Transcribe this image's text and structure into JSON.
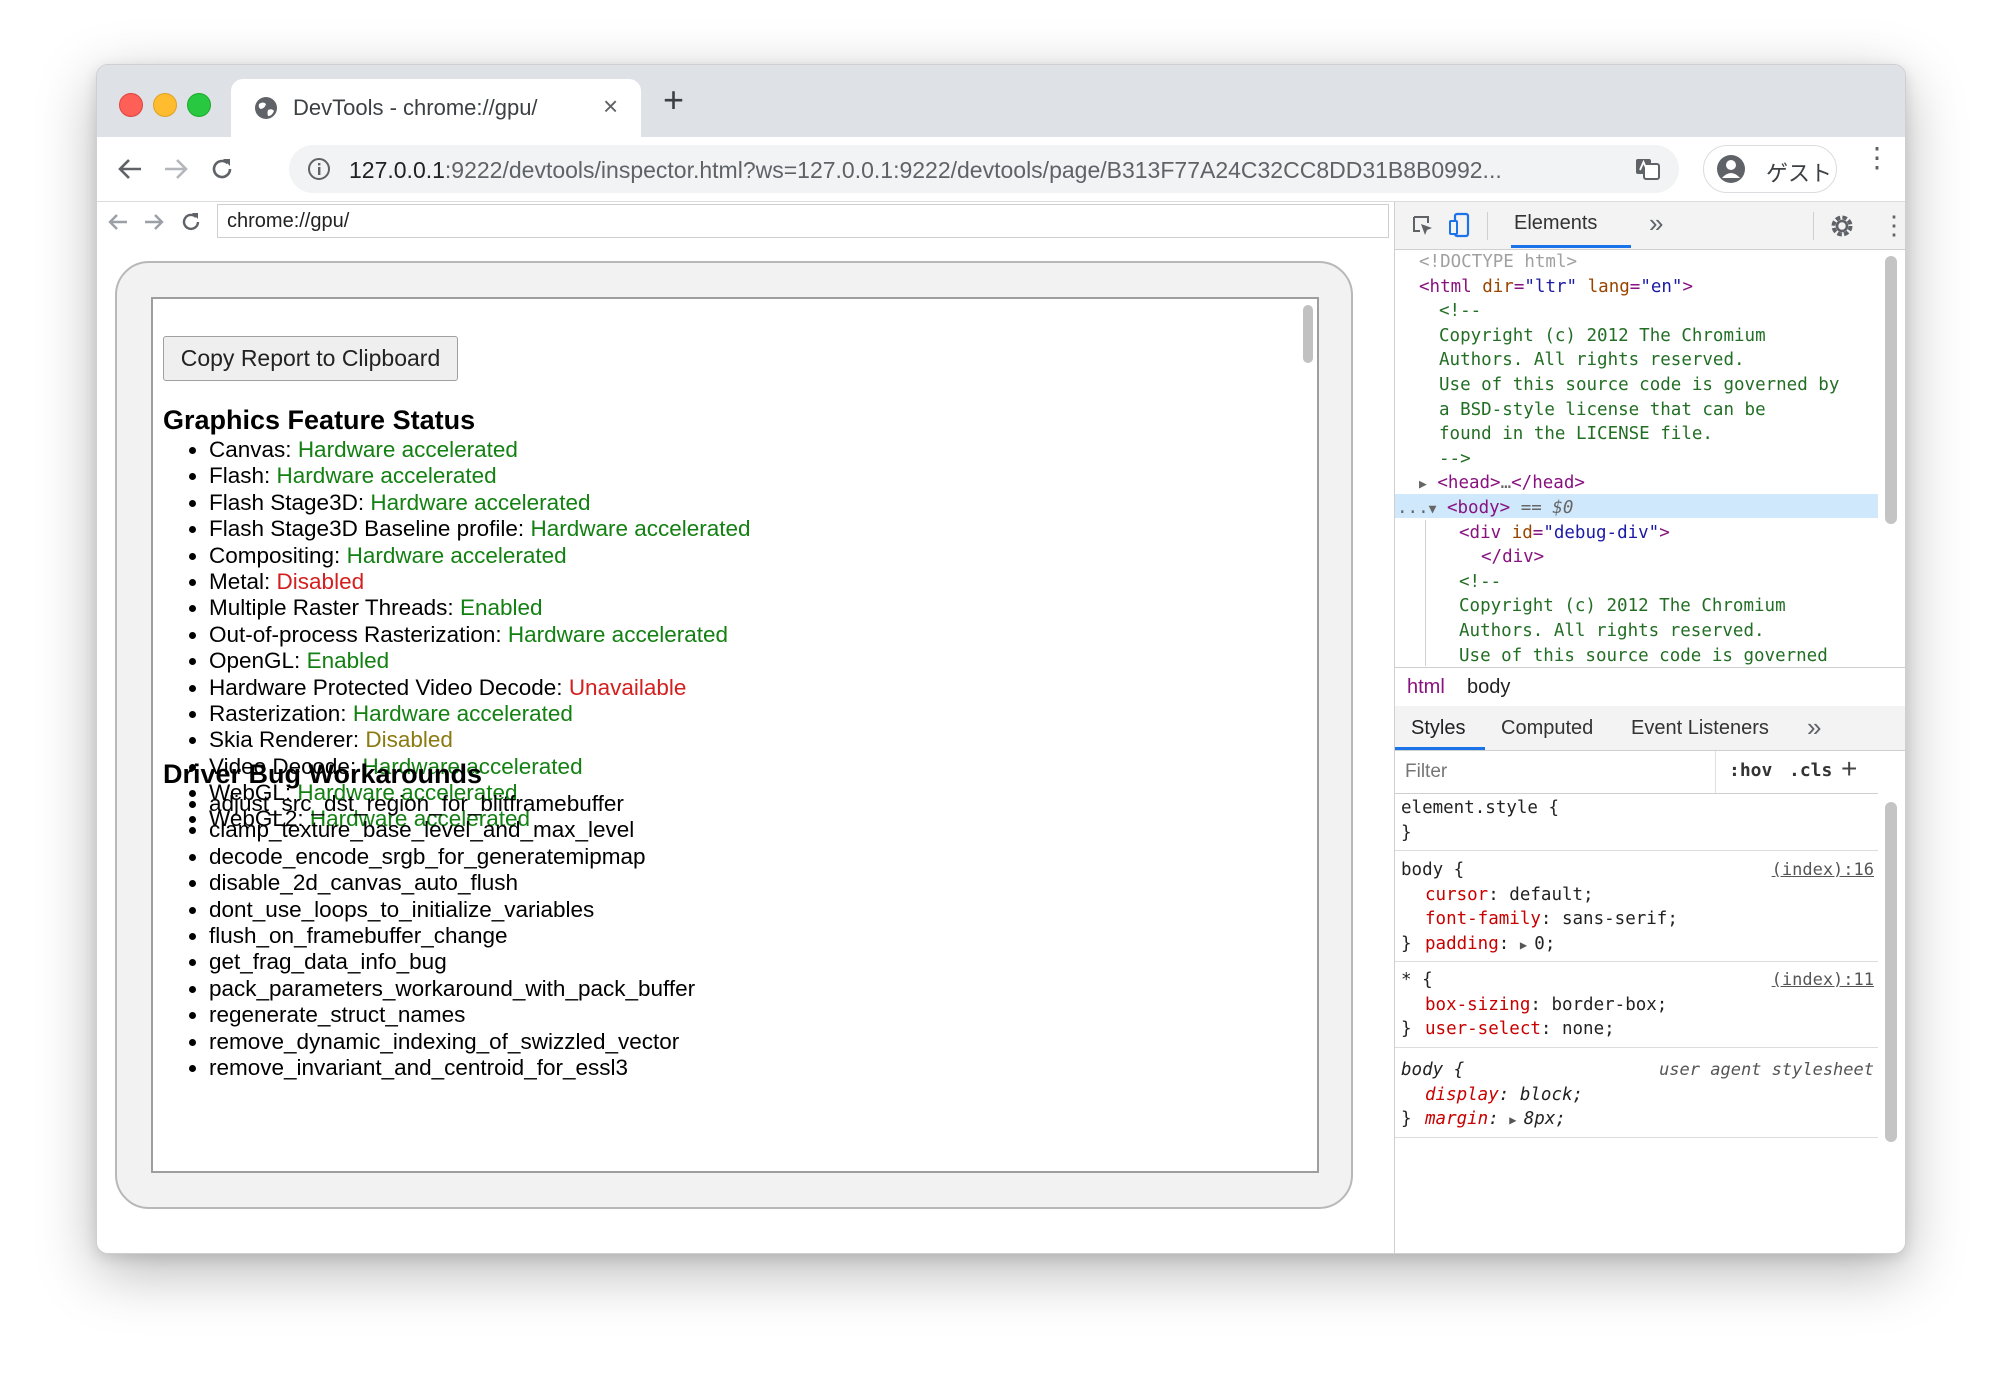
{
  "browser": {
    "tab_title": "DevTools - chrome://gpu/",
    "tab_close": "×",
    "new_tab": "+",
    "url_host": "127.0.0.1",
    "url_rest": ":9222/devtools/inspector.html?ws=127.0.0.1:9222/devtools/page/B313F77A24C32CC8DD31B8B0992...",
    "profile_name": "ゲスト",
    "menu": "⋮"
  },
  "inspector": {
    "url": "chrome://gpu/",
    "copy_button": "Copy Report to Clipboard",
    "feature_status_heading": "Graphics Feature Status",
    "features": [
      {
        "name": "Canvas:",
        "status": "Hardware accelerated",
        "color": "#138012"
      },
      {
        "name": "Flash:",
        "status": "Hardware accelerated",
        "color": "#138012"
      },
      {
        "name": "Flash Stage3D:",
        "status": "Hardware accelerated",
        "color": "#138012"
      },
      {
        "name": "Flash Stage3D Baseline profile:",
        "status": "Hardware accelerated",
        "color": "#138012"
      },
      {
        "name": "Compositing:",
        "status": "Hardware accelerated",
        "color": "#138012"
      },
      {
        "name": "Metal:",
        "status": "Disabled",
        "color": "#d41f1f"
      },
      {
        "name": "Multiple Raster Threads:",
        "status": "Enabled",
        "color": "#138012"
      },
      {
        "name": "Out-of-process Rasterization:",
        "status": "Hardware accelerated",
        "color": "#138012"
      },
      {
        "name": "OpenGL:",
        "status": "Enabled",
        "color": "#138012"
      },
      {
        "name": "Hardware Protected Video Decode:",
        "status": "Unavailable",
        "color": "#d41f1f"
      },
      {
        "name": "Rasterization:",
        "status": "Hardware accelerated",
        "color": "#138012"
      },
      {
        "name": "Skia Renderer:",
        "status": "Disabled",
        "color": "#8a7a10"
      },
      {
        "name": "Video Decode:",
        "status": "Hardware accelerated",
        "color": "#138012"
      },
      {
        "name": "WebGL:",
        "status": "Hardware accelerated",
        "color": "#138012"
      },
      {
        "name": "WebGL2:",
        "status": "Hardware accelerated",
        "color": "#138012"
      }
    ],
    "workarounds_heading": "Driver Bug Workarounds",
    "workarounds": [
      "adjust_src_dst_region_for_blitframebuffer",
      "clamp_texture_base_level_and_max_level",
      "decode_encode_srgb_for_generatemipmap",
      "disable_2d_canvas_auto_flush",
      "dont_use_loops_to_initialize_variables",
      "flush_on_framebuffer_change",
      "get_frag_data_info_bug",
      "pack_parameters_workaround_with_pack_buffer",
      "regenerate_struct_names",
      "remove_dynamic_indexing_of_swizzled_vector",
      "remove_invariant_and_centroid_for_essl3"
    ]
  },
  "devtools": {
    "panel_tab": "Elements",
    "more": "»",
    "dom": {
      "doctype": "<!DOCTYPE html>",
      "html_open_tag": "<html",
      "html_attr1_name": "dir",
      "html_attr1_value": "\"ltr\"",
      "html_attr2_name": "lang",
      "html_attr2_value": "\"en\"",
      "html_close_bracket": ">",
      "comment_lines": [
        "<!--",
        "Copyright (c) 2012 The Chromium",
        "Authors. All rights reserved.",
        "Use of this source code is governed by",
        "a BSD-style license that can be",
        "found in the LICENSE file.",
        "-->"
      ],
      "head_open": "<head>",
      "head_ellipsis": "…",
      "head_close": "</head>",
      "body_dots": "...",
      "body_tag": "<body>",
      "body_marker": "== $0",
      "div_open": "<div",
      "div_attr_name": "id",
      "div_attr_value": "\"debug-div\"",
      "div_close_bracket": ">",
      "div_close": "</div>",
      "comment2_lines": [
        "<!--",
        "Copyright (c) 2012 The Chromium",
        "Authors. All rights reserved.",
        "Use of this source code is governed"
      ]
    },
    "breadcrumbs": [
      "html",
      "body"
    ],
    "style_tabs": [
      "Styles",
      "Computed",
      "Event Listeners"
    ],
    "filter_placeholder": "Filter",
    "hov": ":hov",
    "cls": ".cls",
    "add": "+",
    "rules": {
      "element_style": "element.style {",
      "close": "}",
      "body1_selector": "body {",
      "body1_source": "(index):16",
      "body1_props": [
        {
          "name": "cursor",
          "value": "default;"
        },
        {
          "name": "font-family",
          "value": "sans-serif;"
        },
        {
          "name": "padding",
          "value": "0;"
        }
      ],
      "star_selector": "* {",
      "star_source": "(index):11",
      "star_props": [
        {
          "name": "box-sizing",
          "value": "border-box;"
        },
        {
          "name": "user-select",
          "value": "none;"
        }
      ],
      "body2_selector": "body {",
      "body2_source": "user agent stylesheet",
      "body2_props": [
        {
          "name": "display",
          "value": "block;"
        },
        {
          "name": "margin",
          "value": "8px;"
        }
      ]
    }
  },
  "colors": {
    "green": "#138012",
    "red": "#d41f1f",
    "olive": "#8a7a10",
    "accent": "#1a73e8"
  }
}
